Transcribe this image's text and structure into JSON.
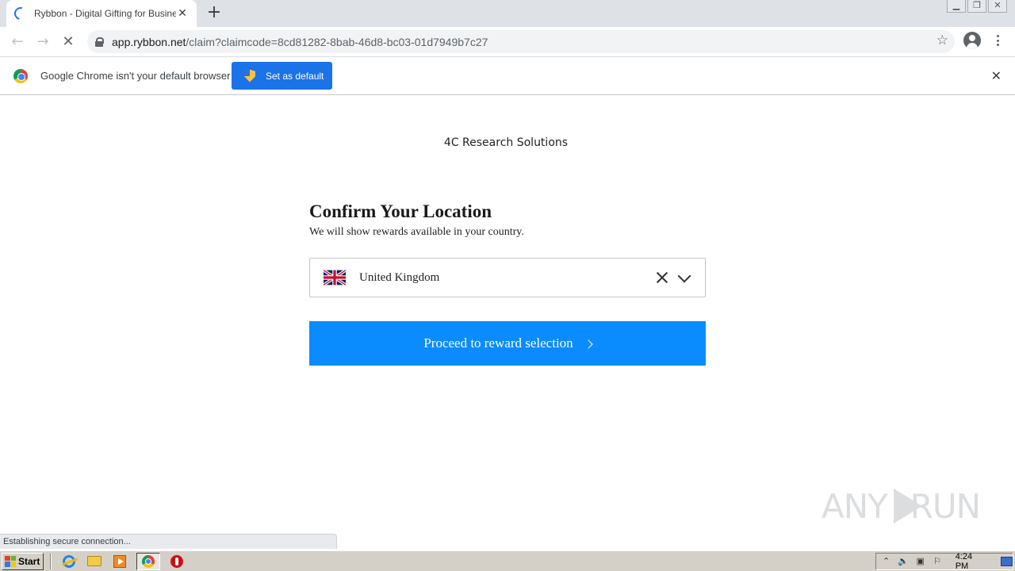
{
  "browser": {
    "tab": {
      "title": "Rybbon - Digital Gifting for Business",
      "close": "✕"
    },
    "new_tab": "+",
    "window_controls": [
      "▁",
      "❐",
      "✕"
    ],
    "nav": {
      "back": "←",
      "forward": "→",
      "reload": "✕"
    },
    "url": {
      "host": "app.rybbon.net",
      "path": "/claim?claimcode=8cd81282-8bab-46d8-bc03-01d7949b7c27"
    },
    "star": "☆"
  },
  "infobar": {
    "message": "Google Chrome isn't your default browser",
    "button": "Set as default",
    "close": "✕"
  },
  "page": {
    "company": "4C Research Solutions",
    "heading": "Confirm Your Location",
    "subheading": "We will show rewards available in your country.",
    "country": {
      "value": "United Kingdom",
      "flag_icon": "uk-flag-icon"
    },
    "proceed_button": "Proceed to reward selection"
  },
  "status_bar": "Establishing secure connection...",
  "watermark": {
    "left": "ANY",
    "right": "RUN"
  },
  "taskbar": {
    "start": "Start",
    "apps": [
      "internet-explorer-icon",
      "folder-icon",
      "media-player-icon",
      "chrome-icon",
      "opera-icon"
    ],
    "clock": "4:24 PM"
  },
  "colors": {
    "accent_blue": "#0a8cff",
    "chrome_blue": "#1a73e8",
    "taskbar": "#d4d0c8"
  }
}
